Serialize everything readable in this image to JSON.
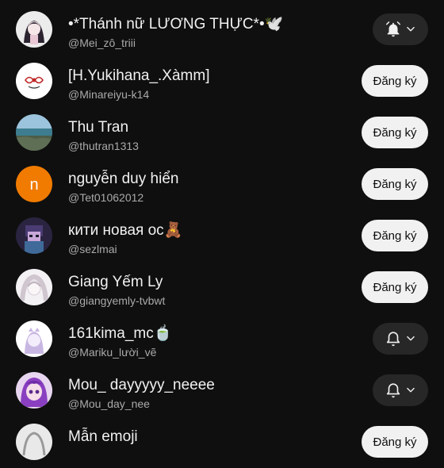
{
  "channels": [
    {
      "name": "•*Thánh nữ LƯƠNG THỰC*•🕊️",
      "handle": "@Mei_zô_triii",
      "button": "bell",
      "avatar": "anime-girl-dark-hair"
    },
    {
      "name": "[H.Yukihana_.Xàmm]",
      "handle": "@Minareiyu-k14",
      "button": "subscribe",
      "subscribe_label": "Đăng ký",
      "avatar": "red-bow-doodle"
    },
    {
      "name": "Thu Tran",
      "handle": "@thutran1313",
      "button": "subscribe",
      "subscribe_label": "Đăng ký",
      "avatar": "seaside-landscape"
    },
    {
      "name": "nguyễn duy hiển",
      "handle": "@Tet01062012",
      "button": "subscribe",
      "subscribe_label": "Đăng ký",
      "avatar": "letter-avatar",
      "avatar_letter": "n",
      "avatar_color": "#f07b00"
    },
    {
      "name": "кити новая ос🧸",
      "handle": "@sezlmai",
      "button": "subscribe",
      "subscribe_label": "Đăng ký",
      "avatar": "purple-pixel-character"
    },
    {
      "name": "Giang Yếm Ly",
      "handle": "@giangyemly-tvbwt",
      "button": "subscribe",
      "subscribe_label": "Đăng ký",
      "avatar": "white-hair-sketch"
    },
    {
      "name": "161kima_mc🍵",
      "handle": "@Mariku_lười_vẽ",
      "button": "bell",
      "avatar": "lavender-character"
    },
    {
      "name": "Mou_ dayyyyy_neeee",
      "handle": "@Mou_day_nee",
      "button": "bell",
      "avatar": "purple-hair-anime"
    },
    {
      "name": "Mẫn emoji",
      "handle": "",
      "button": "subscribe",
      "subscribe_label": "Đăng ký",
      "avatar": "gray-sketch"
    }
  ],
  "icons": {
    "bell": "bell-icon",
    "chevron": "chevron-down-icon"
  },
  "colors": {
    "background": "#0f0f0f",
    "subscribe_bg": "#f1f1f1",
    "bell_bg": "#272727",
    "secondary_text": "#aaaaaa"
  }
}
